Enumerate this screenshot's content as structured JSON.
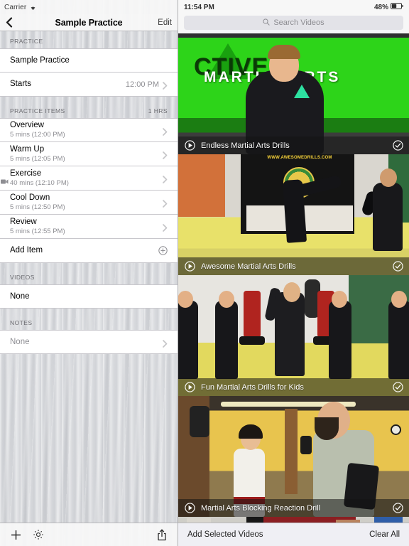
{
  "left": {
    "status": {
      "carrier": "Carrier",
      "wifi_icon": "wifi-icon"
    },
    "nav": {
      "back_icon": "back-chevron-icon",
      "title": "Sample Practice",
      "edit_label": "Edit"
    },
    "sections": [
      {
        "header": "PRACTICE",
        "header_right": "",
        "rows": [
          {
            "title": "Sample Practice",
            "sub": "",
            "value": "",
            "chevron": false
          },
          {
            "title": "Starts",
            "sub": "",
            "value": "12:00 PM",
            "chevron": true
          }
        ]
      },
      {
        "header": "PRACTICE ITEMS",
        "header_right": "1 HRS",
        "rows": [
          {
            "title": "Overview",
            "sub": "5 mins (12:00 PM)",
            "value": "",
            "chevron": true
          },
          {
            "title": "Warm Up",
            "sub": "5 mins (12:05 PM)",
            "value": "",
            "chevron": true
          },
          {
            "title": "Exercise",
            "sub": "40 mins (12:10 PM)",
            "value": "",
            "chevron": true,
            "camera": true
          },
          {
            "title": "Cool Down",
            "sub": "5 mins (12:50 PM)",
            "value": "",
            "chevron": true
          },
          {
            "title": "Review",
            "sub": "5 mins (12:55 PM)",
            "value": "",
            "chevron": true
          },
          {
            "title": "Add Item",
            "sub": "",
            "value": "",
            "plus": true
          }
        ]
      },
      {
        "header": "VIDEOS",
        "header_right": "",
        "rows": [
          {
            "title": "None",
            "sub": "",
            "value": "",
            "chevron": false
          }
        ]
      },
      {
        "header": "NOTES",
        "header_right": "",
        "rows": [
          {
            "title": "None",
            "sub": "",
            "value": "",
            "chevron": true,
            "muted": true
          }
        ]
      }
    ],
    "toolbar": {
      "add_icon": "plus-icon",
      "settings_icon": "gear-icon",
      "share_icon": "share-icon"
    }
  },
  "right": {
    "status": {
      "time": "11:54 PM",
      "battery_percent": "48%",
      "battery_icon": "battery-icon"
    },
    "search": {
      "placeholder": "Search Videos",
      "value": "",
      "icon": "search-icon"
    },
    "videos": [
      {
        "title": "Endless Martial Arts Drills",
        "play_icon": "play-icon",
        "select_icon": "check-circle-icon",
        "selected": false
      },
      {
        "title": "Awesome Martial Arts Drills",
        "play_icon": "play-icon",
        "select_icon": "check-circle-icon",
        "selected": false
      },
      {
        "title": "Fun Martial Arts Drills for Kids",
        "play_icon": "play-icon",
        "select_icon": "check-circle-icon",
        "selected": false
      },
      {
        "title": "Martial Arts Blocking Reaction Drill",
        "play_icon": "play-icon",
        "select_icon": "check-circle-icon",
        "selected": false
      }
    ],
    "toolbar": {
      "add_selected_label": "Add Selected Videos",
      "clear_all_label": "Clear All"
    }
  },
  "colors": {
    "tint": "#007aff",
    "separator": "#c8c7cc",
    "section_header_text": "#6d6d72",
    "secondary_text": "#8e8e93",
    "toolbar_bg": "#efeff4"
  }
}
